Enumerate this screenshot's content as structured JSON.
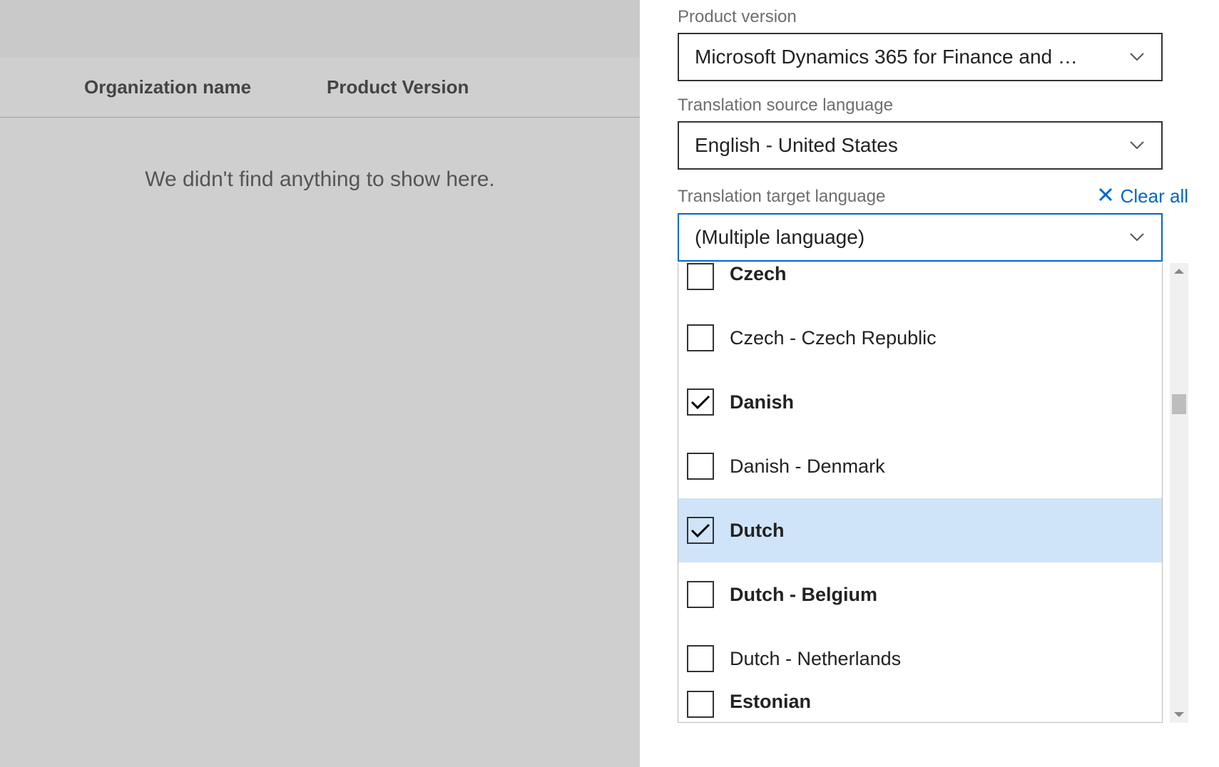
{
  "left": {
    "columns": {
      "organization": "Organization name",
      "product": "Product Version"
    },
    "empty_message": "We didn't find anything to show here."
  },
  "form": {
    "product_version_label": "Product version",
    "product_version_value": "Microsoft Dynamics 365 for Finance and …",
    "source_language_label": "Translation source language",
    "source_language_value": "English - United States",
    "target_language_label": "Translation target language",
    "clear_all_label": "Clear all",
    "target_language_value": "(Multiple language)"
  },
  "target_options": [
    {
      "label": "Czech",
      "checked": false,
      "bold": true,
      "highlight": false
    },
    {
      "label": "Czech - Czech Republic",
      "checked": false,
      "bold": false,
      "highlight": false
    },
    {
      "label": "Danish",
      "checked": true,
      "bold": true,
      "highlight": false
    },
    {
      "label": "Danish - Denmark",
      "checked": false,
      "bold": false,
      "highlight": false
    },
    {
      "label": "Dutch",
      "checked": true,
      "bold": true,
      "highlight": true
    },
    {
      "label": "Dutch - Belgium",
      "checked": false,
      "bold": true,
      "highlight": false
    },
    {
      "label": "Dutch - Netherlands",
      "checked": false,
      "bold": false,
      "highlight": false
    },
    {
      "label": "Estonian",
      "checked": false,
      "bold": true,
      "highlight": false
    }
  ]
}
